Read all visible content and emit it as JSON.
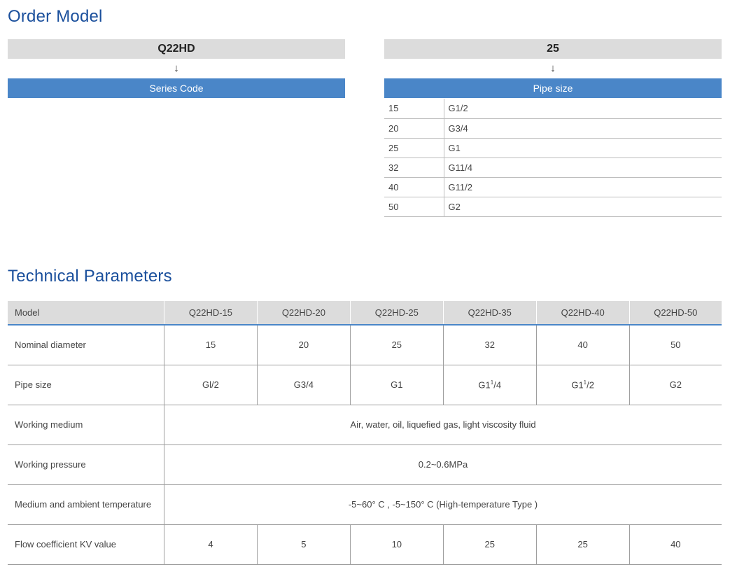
{
  "order_model": {
    "title": "Order Model",
    "series": {
      "code": "Q22HD",
      "arrow": "↓",
      "label": "Series Code"
    },
    "pipe": {
      "code": "25",
      "arrow": "↓",
      "label": "Pipe size",
      "rows": [
        {
          "size": "15",
          "thread": "G1/2"
        },
        {
          "size": "20",
          "thread": "G3/4"
        },
        {
          "size": "25",
          "thread": "G1"
        },
        {
          "size": "32",
          "thread": "G11/4"
        },
        {
          "size": "40",
          "thread": "G11/2"
        },
        {
          "size": "50",
          "thread": "G2"
        }
      ]
    }
  },
  "tech": {
    "title": "Technical Parameters",
    "header": [
      "Model",
      "Q22HD-15",
      "Q22HD-20",
      "Q22HD-25",
      "Q22HD-35",
      "Q22HD-40",
      "Q22HD-50"
    ],
    "nominal_diameter": {
      "label": "Nominal diameter",
      "values": [
        "15",
        "20",
        "25",
        "32",
        "40",
        "50"
      ]
    },
    "pipe_size": {
      "label": "Pipe size",
      "values": [
        "Gl/2",
        "G3/4",
        "G1",
        {
          "base": "G1",
          "sup": "1",
          "rest": "/4"
        },
        {
          "base": "G1",
          "sup": "1",
          "rest": "/2"
        },
        "G2"
      ]
    },
    "working_medium": {
      "label": "Working medium",
      "value": "Air, water, oil, liquefied gas, light viscosity fluid"
    },
    "working_pressure": {
      "label": "Working pressure",
      "value": "0.2~0.6MPa"
    },
    "temperature": {
      "label": "Medium and ambient temperature",
      "value": "-5~60° C , -5~150° C (High-temperature Type )"
    },
    "flow_kv": {
      "label": "Flow coefficient KV value",
      "values": [
        "4",
        "5",
        "10",
        "25",
        "25",
        "40"
      ]
    }
  }
}
